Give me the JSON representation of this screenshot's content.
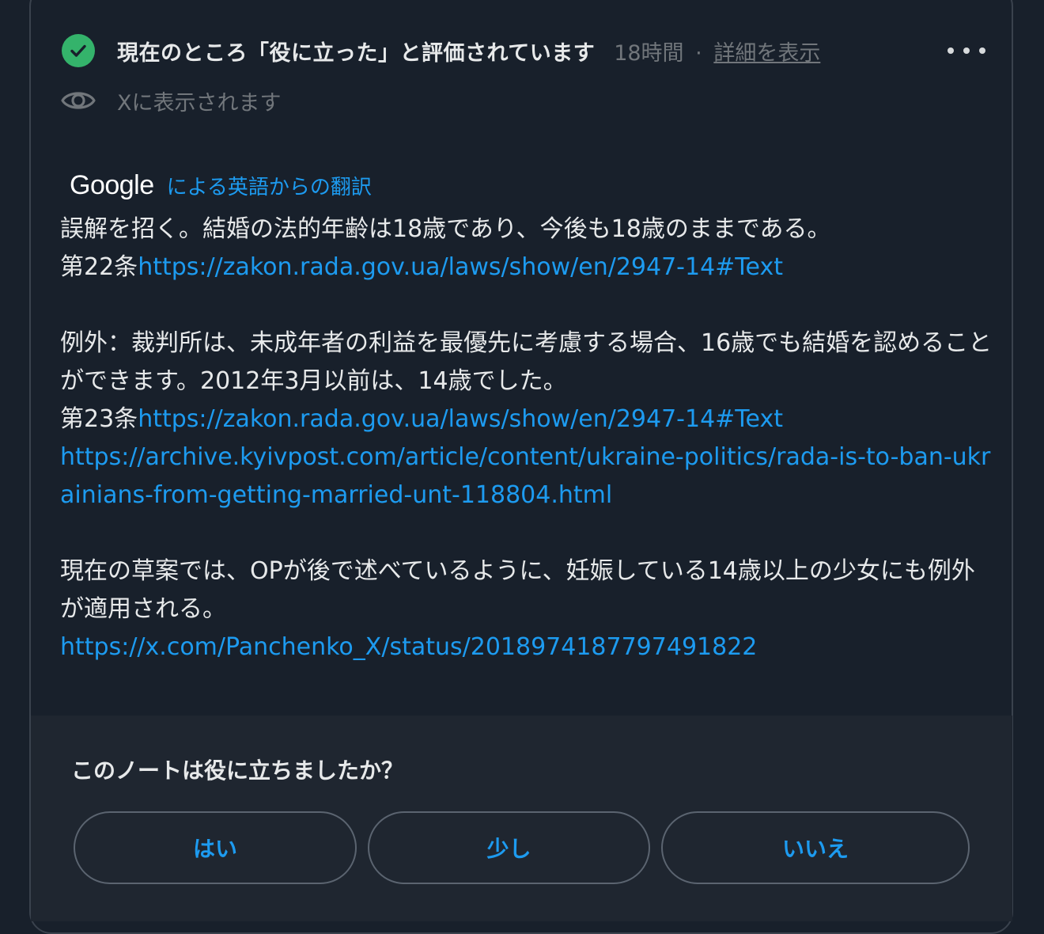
{
  "header": {
    "status": "現在のところ「役に立った」と評価されています",
    "time": "18時間",
    "separator": "·",
    "details_link": "詳細を表示"
  },
  "visibility": {
    "text": "Xに表示されます"
  },
  "translation": {
    "provider": "Google",
    "label": "による英語からの翻訳"
  },
  "note": {
    "p1": "誤解を招く。結婚の法的年齢は18歳であり、今後も18歳のままである。",
    "p1_prefix": "第22条",
    "p1_link": "https://zakon.rada.gov.ua/laws/show/en/2947-14#Text",
    "p2": "例外：裁判所は、未成年者の利益を最優先に考慮する場合、16歳でも結婚を認めることができます。2012年3月以前は、14歳でした。",
    "p2_prefix": "第23条",
    "p2_link": "https://zakon.rada.gov.ua/laws/show/en/2947-14#Text",
    "p2_link2": "https://archive.kyivpost.com/article/content/ukraine-politics/rada-is-to-ban-ukrainians-from-getting-married-unt-118804.html",
    "p3": "現在の草案では、OPが後で述べているように、妊娠している14歳以上の少女にも例外が適用される。",
    "p3_link": "https://x.com/Panchenko_X/status/2018974187797491822"
  },
  "feedback": {
    "question": "このノートは役に立ちましたか？",
    "yes": "はい",
    "somewhat": "少し",
    "no": "いいえ"
  },
  "colors": {
    "background": "#18202b",
    "accent_link": "#1d9bf0",
    "check_green": "#34b36b",
    "muted_text": "#71767b"
  },
  "icons": [
    "check-icon",
    "eye-icon",
    "more-icon"
  ]
}
